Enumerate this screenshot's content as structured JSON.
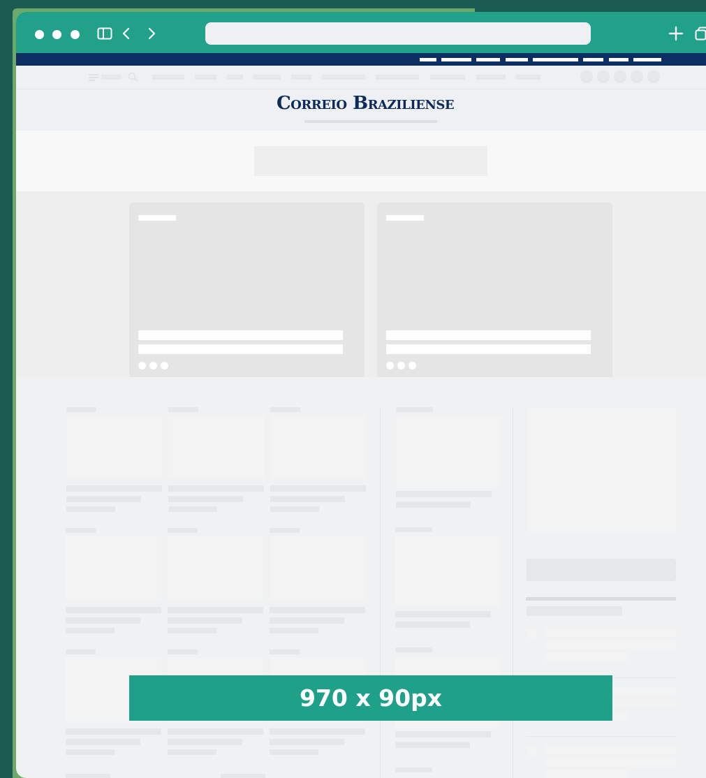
{
  "browser": {
    "window_controls": [
      "close",
      "minimize",
      "maximize"
    ],
    "icons": [
      "sidebar-icon",
      "back-icon",
      "forward-icon",
      "new-tab-icon",
      "tabs-overview-icon"
    ],
    "address_value": ""
  },
  "site": {
    "logo": "Correio Braziliense",
    "social_icons": [
      "whatsapp-icon",
      "facebook-icon",
      "twitter-icon",
      "spotify-icon",
      "youtube-icon"
    ]
  },
  "ad_banner": {
    "label": "970 x 90px"
  },
  "colors": {
    "titlebar": "#21a08a",
    "navy_bar": "#0d2e63",
    "logo": "#0e2a59",
    "banner": "#1fa088",
    "placeholder": "#e5e5e6"
  }
}
